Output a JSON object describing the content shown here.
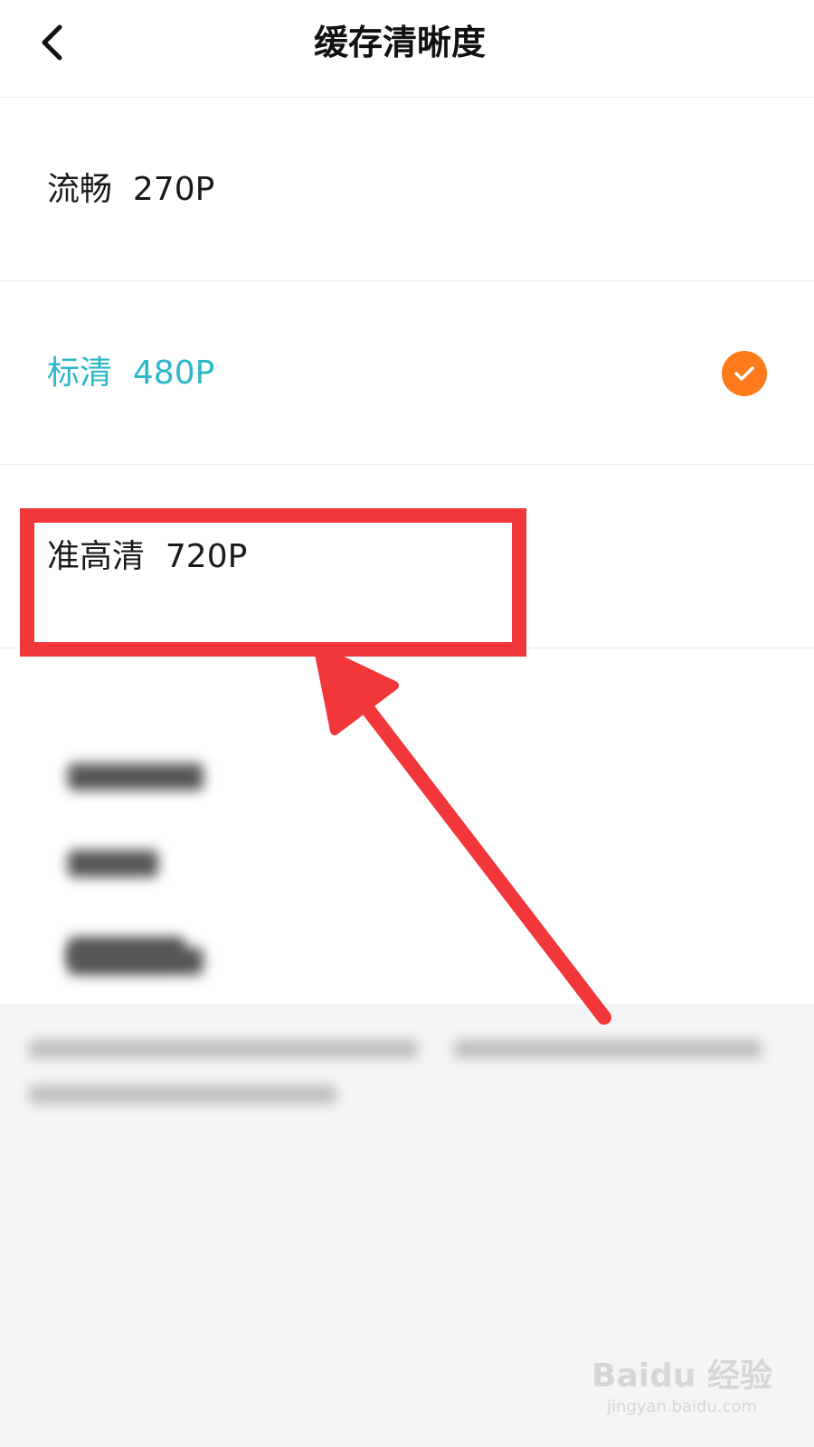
{
  "header": {
    "title": "缓存清晰度",
    "back_icon": "chevron-left-icon"
  },
  "options": [
    {
      "label": "流畅  270P",
      "selected": false
    },
    {
      "label": "标清  480P",
      "selected": true
    },
    {
      "label": "准高清  720P",
      "selected": false
    }
  ],
  "colors": {
    "selected_text": "#2bb8c8",
    "check_badge": "#ff7a1a",
    "annotation_red": "#f2373b"
  },
  "watermark": {
    "logo": "Baidu 经验",
    "url": "jingyan.baidu.com"
  }
}
